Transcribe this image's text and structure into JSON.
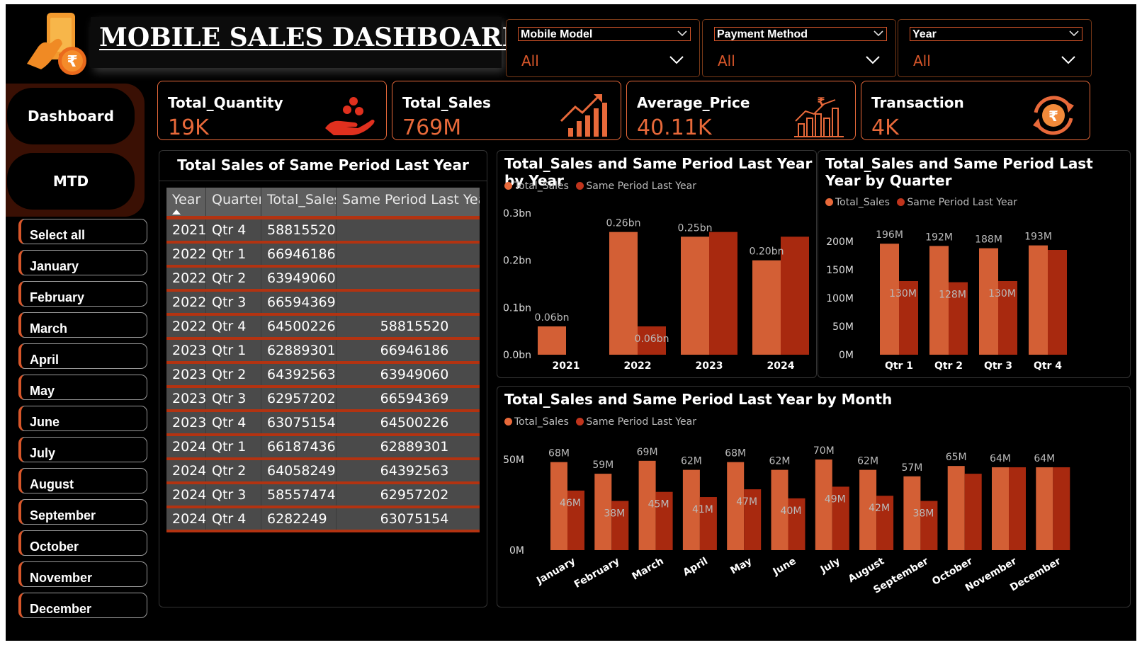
{
  "header": {
    "title": "MOBILE SALES DASHBOARD"
  },
  "filters": [
    {
      "label": "Mobile Model",
      "selected": "All"
    },
    {
      "label": "Payment Method",
      "selected": "All"
    },
    {
      "label": "Year",
      "selected": "All"
    }
  ],
  "nav": {
    "dashboard": "Dashboard",
    "mtd": "MTD"
  },
  "months": [
    "Select all",
    "January",
    "February",
    "March",
    "April",
    "May",
    "June",
    "July",
    "August",
    "September",
    "October",
    "November",
    "December"
  ],
  "kpis": [
    {
      "label": "Total_Quantity",
      "value": "19K",
      "icon": "hand-coins-icon"
    },
    {
      "label": "Total_Sales",
      "value": "769M",
      "icon": "growth-chart-icon"
    },
    {
      "label": "Average_Price",
      "value": "40.11K",
      "icon": "rupee-bar-chart-icon"
    },
    {
      "label": "Transaction",
      "value": "4K",
      "icon": "rupee-cycle-icon"
    }
  ],
  "colors": {
    "accent": "#e8693a",
    "total_sales": "#d35f35",
    "same_period": "#a8290f",
    "table_row": "#4a4a4a",
    "table_rule": "#b33311"
  },
  "table": {
    "title": "Total Sales of Same Period Last Year",
    "columns": [
      "Year",
      "Quarter",
      "Total_Sales",
      "Same Period Last Year"
    ],
    "rows": [
      [
        "2021",
        "Qtr 4",
        "58815520",
        ""
      ],
      [
        "2022",
        "Qtr 1",
        "66946186",
        ""
      ],
      [
        "2022",
        "Qtr 2",
        "63949060",
        ""
      ],
      [
        "2022",
        "Qtr 3",
        "66594369",
        ""
      ],
      [
        "2022",
        "Qtr 4",
        "64500226",
        "58815520"
      ],
      [
        "2023",
        "Qtr 1",
        "62889301",
        "66946186"
      ],
      [
        "2023",
        "Qtr 2",
        "64392563",
        "63949060"
      ],
      [
        "2023",
        "Qtr 3",
        "62957202",
        "66594369"
      ],
      [
        "2023",
        "Qtr 4",
        "63075154",
        "64500226"
      ],
      [
        "2024",
        "Qtr 1",
        "66187436",
        "62889301"
      ],
      [
        "2024",
        "Qtr 2",
        "64058249",
        "64392563"
      ],
      [
        "2024",
        "Qtr 3",
        "58557474",
        "62957202"
      ],
      [
        "2024",
        "Qtr 4",
        "6282249",
        "63075154"
      ]
    ]
  },
  "chart_data": [
    {
      "type": "bar",
      "title": "Total_Sales and Same Period Last Year by Year",
      "categories": [
        "2021",
        "2022",
        "2023",
        "2024"
      ],
      "series": [
        {
          "name": "Total_Sales",
          "values": [
            0.06,
            0.26,
            0.25,
            0.2
          ],
          "labels": [
            "0.06bn",
            "0.26bn",
            "0.25bn",
            "0.20bn"
          ]
        },
        {
          "name": "Same Period Last Year",
          "values": [
            null,
            0.06,
            0.26,
            0.25
          ],
          "labels": [
            "",
            "0.06bn",
            "",
            ""
          ]
        }
      ],
      "yticks": [
        "0.0bn",
        "0.1bn",
        "0.2bn",
        "0.3bn"
      ],
      "ylim": [
        0,
        0.3
      ],
      "legend": "top-left",
      "grid": false
    },
    {
      "type": "bar",
      "title": "Total_Sales and Same Period Last Year by Quarter",
      "categories": [
        "Qtr 1",
        "Qtr 2",
        "Qtr 3",
        "Qtr 4"
      ],
      "series": [
        {
          "name": "Total_Sales",
          "values": [
            196,
            192,
            188,
            193
          ],
          "labels": [
            "196M",
            "192M",
            "188M",
            "193M"
          ]
        },
        {
          "name": "Same Period Last Year",
          "values": [
            130,
            128,
            130,
            185
          ],
          "labels": [
            "130M",
            "128M",
            "130M",
            ""
          ]
        }
      ],
      "yticks": [
        "0M",
        "50M",
        "100M",
        "150M",
        "200M"
      ],
      "ylim": [
        0,
        200
      ],
      "legend": "top-left",
      "grid": false
    },
    {
      "type": "bar",
      "title": "Total_Sales and Same Period Last Year by Month",
      "categories": [
        "January",
        "February",
        "March",
        "April",
        "May",
        "June",
        "July",
        "August",
        "September",
        "October",
        "November",
        "December"
      ],
      "series": [
        {
          "name": "Total_Sales",
          "values": [
            68,
            59,
            69,
            62,
            68,
            62,
            70,
            62,
            57,
            65,
            64,
            64
          ],
          "labels": [
            "68M",
            "59M",
            "69M",
            "62M",
            "68M",
            "62M",
            "70M",
            "62M",
            "57M",
            "65M",
            "64M",
            "64M"
          ]
        },
        {
          "name": "Same Period Last Year",
          "values": [
            46,
            38,
            45,
            41,
            47,
            40,
            49,
            42,
            38,
            59,
            64,
            64
          ],
          "labels": [
            "46M",
            "38M",
            "45M",
            "41M",
            "47M",
            "40M",
            "49M",
            "42M",
            "38M",
            "",
            "",
            ""
          ]
        }
      ],
      "yticks": [
        "0M",
        "50M"
      ],
      "ylim": [
        0,
        70
      ],
      "legend": "top-left",
      "grid": false
    }
  ]
}
